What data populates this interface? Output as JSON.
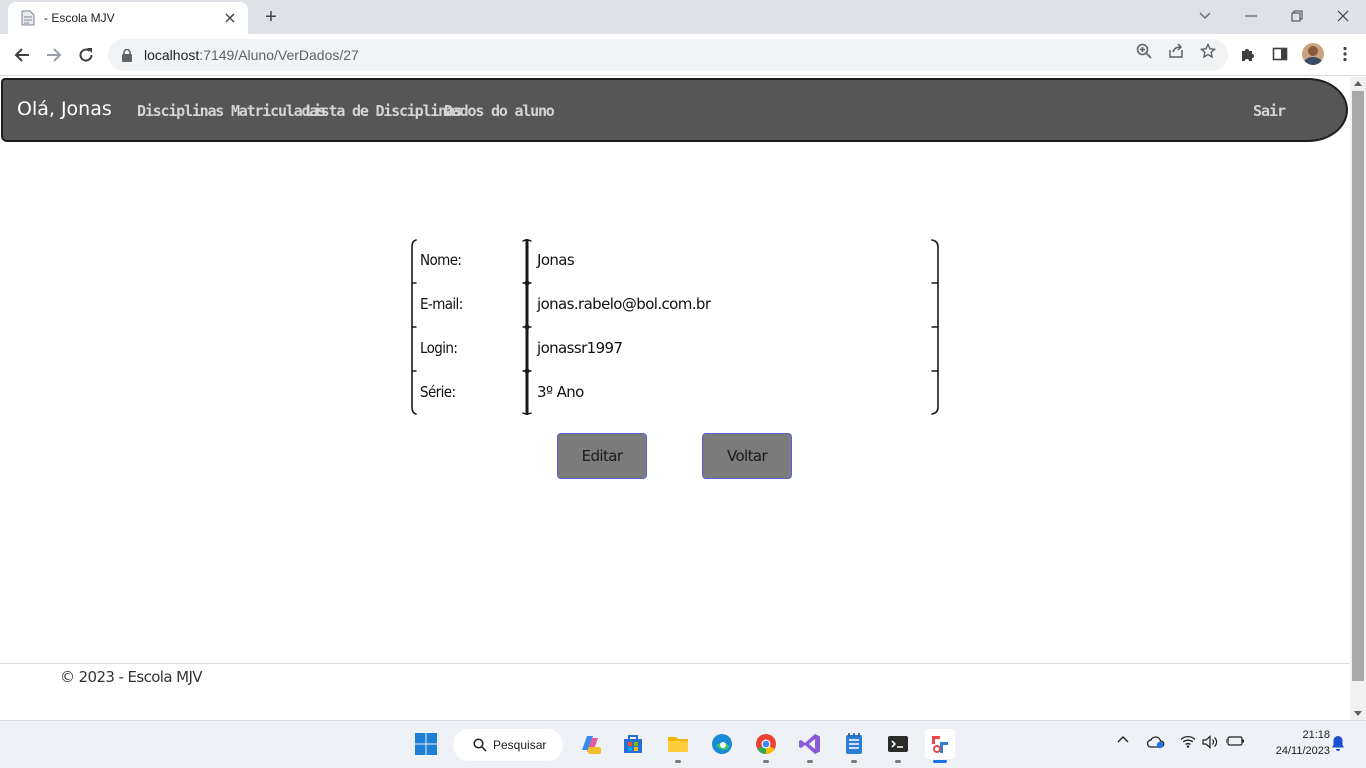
{
  "browser": {
    "tab_title": "- Escola MJV",
    "url_host": "localhost",
    "url_path": ":7149/Aluno/VerDados/27"
  },
  "site": {
    "brand": "Olá, Jonas",
    "nav": [
      {
        "label": "Disciplinas Matriculadas"
      },
      {
        "label": "Lista de Disciplinas"
      },
      {
        "label": "Dados do aluno"
      }
    ],
    "logout": "Sair"
  },
  "student": {
    "rows": [
      {
        "label": "Nome:",
        "value": "Jonas"
      },
      {
        "label": "E-mail:",
        "value": "jonas.rabelo@bol.com.br"
      },
      {
        "label": "Login:",
        "value": "jonassr1997"
      },
      {
        "label": "Série:",
        "value": "3º Ano"
      }
    ]
  },
  "actions": {
    "edit": "Editar",
    "back": "Voltar"
  },
  "footer": {
    "text": "© 2023 - Escola MJV"
  },
  "taskbar": {
    "search_label": "Pesquisar",
    "time": "21:18",
    "date": "24/11/2023"
  }
}
